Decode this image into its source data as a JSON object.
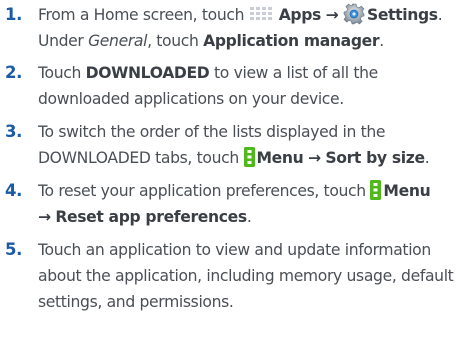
{
  "steps": [
    {
      "number": "1.",
      "t1": "From a Home screen, touch",
      "apps": "Apps",
      "arrow": "→",
      "settings": "Settings",
      "t2": ".",
      "t3": "Under",
      "general": "General",
      "t4": ", touch",
      "appmgr": "Application manager",
      "t5": "."
    },
    {
      "number": "2.",
      "t1": "Touch",
      "downloaded": "DOWNLOADED",
      "t2": "to view a list of all the downloaded applications on your device."
    },
    {
      "number": "3.",
      "t1": "To switch the order of the lists displayed in the DOWNLOADED tabs, touch",
      "menu": "Menu",
      "arrow": "→",
      "sort": "Sort by size",
      "t2": "."
    },
    {
      "number": "4.",
      "t1": "To reset your application preferences, touch",
      "menu": "Menu",
      "arrow": "→",
      "reset": "Reset app preferences",
      "t2": "."
    },
    {
      "number": "5.",
      "t1": "Touch an application to view and update information about the application, including memory usage, default settings, and permissions."
    }
  ],
  "icons": {
    "apps": "apps-grid-icon",
    "settings": "settings-gear-icon",
    "menu": "menu-icon"
  },
  "colors": {
    "number": "#1a5aa6",
    "text": "#4a4f55",
    "apps_icon": "#c9ced4",
    "menu_icon": "#4fb81a"
  }
}
